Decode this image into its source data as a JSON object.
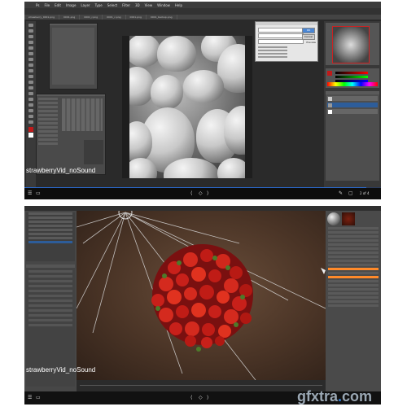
{
  "top": {
    "menu": [
      "Ps",
      "File",
      "Edit",
      "Image",
      "Layer",
      "Type",
      "Select",
      "Filter",
      "3D",
      "View",
      "Window",
      "Help"
    ],
    "doc_tabs": [
      "strawberry_0001.png",
      "0001.png",
      "0001_r.png",
      "0001_c.png",
      "0001.png",
      "0001_backup.png"
    ],
    "watermark": "strawberryVid_noSound",
    "page_counter": "2 of 4",
    "dialog": {
      "btn_ok": "OK",
      "btn_cancel": "Cancel",
      "check_preview": "Preview"
    },
    "progress_pct": 96
  },
  "bottom": {
    "watermark": "strawberryVid_noSound"
  },
  "branding": {
    "logo_text_main": "gfxtra",
    "logo_text_dot": ".",
    "logo_text_tld": "com"
  }
}
